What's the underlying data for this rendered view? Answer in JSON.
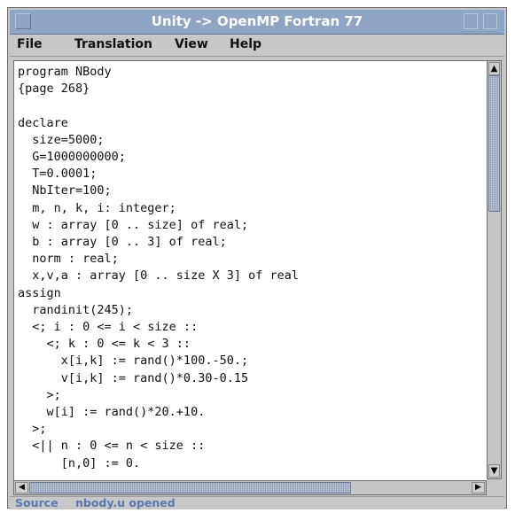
{
  "window": {
    "title": "Unity -> OpenMP Fortran 77"
  },
  "menu": {
    "items": [
      "File",
      "Translation",
      "View",
      "Help"
    ]
  },
  "editor": {
    "lines": [
      "program NBody",
      "{page 268}",
      "",
      "declare",
      "  size=5000;",
      "  G=1000000000;",
      "  T=0.0001;",
      "  NbIter=100;",
      "  m, n, k, i: integer;",
      "  w : array [0 .. size] of real;",
      "  b : array [0 .. 3] of real;",
      "  norm : real;",
      "  x,v,a : array [0 .. size X 3] of real",
      "assign",
      "  randinit(245);",
      "  <; i : 0 <= i < size ::",
      "    <; k : 0 <= k < 3 ::",
      "      x[i,k] := rand()*100.-50.;",
      "      v[i,k] := rand()*0.30-0.15",
      "    >;",
      "    w[i] := rand()*20.+10.",
      "  >;",
      "  <|| n : 0 <= n < size ::",
      "      [n,0] := 0."
    ]
  },
  "statusbar": {
    "mode": "Source",
    "message": "nbody.u opened"
  },
  "scrollbars": {
    "vertical": {
      "up_arrow": "▲",
      "down_arrow": "▼"
    },
    "horizontal": {
      "left_arrow": "◀",
      "right_arrow": "▶"
    }
  }
}
